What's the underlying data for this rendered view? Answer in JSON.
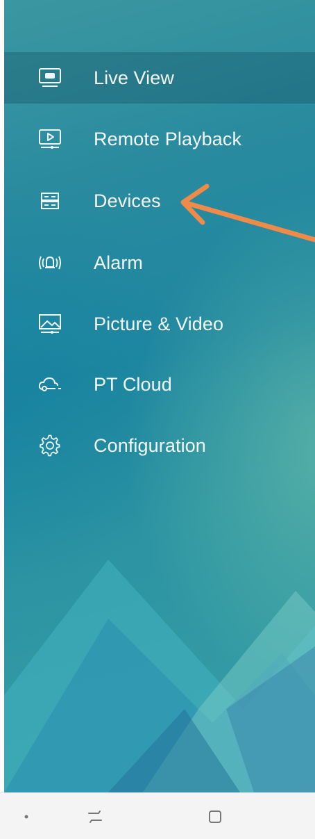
{
  "menu": {
    "items": [
      {
        "label": "Live View",
        "icon": "live-view-monitor-icon",
        "active": true
      },
      {
        "label": "Remote Playback",
        "icon": "playback-icon"
      },
      {
        "label": "Devices",
        "icon": "devices-icon"
      },
      {
        "label": "Alarm",
        "icon": "alarm-bell-icon"
      },
      {
        "label": "Picture & Video",
        "icon": "picture-video-icon"
      },
      {
        "label": "PT Cloud",
        "icon": "cloud-icon"
      },
      {
        "label": "Configuration",
        "icon": "gear-icon"
      }
    ]
  },
  "colors": {
    "accent_arrow": "#f08a48",
    "active_row": "#1c5c6e",
    "text": "#f4f8fa",
    "navbar": "#f4f4f4"
  },
  "navbar": {
    "buttons": [
      "dot-icon",
      "recent-apps-icon",
      "back-square-icon"
    ]
  }
}
